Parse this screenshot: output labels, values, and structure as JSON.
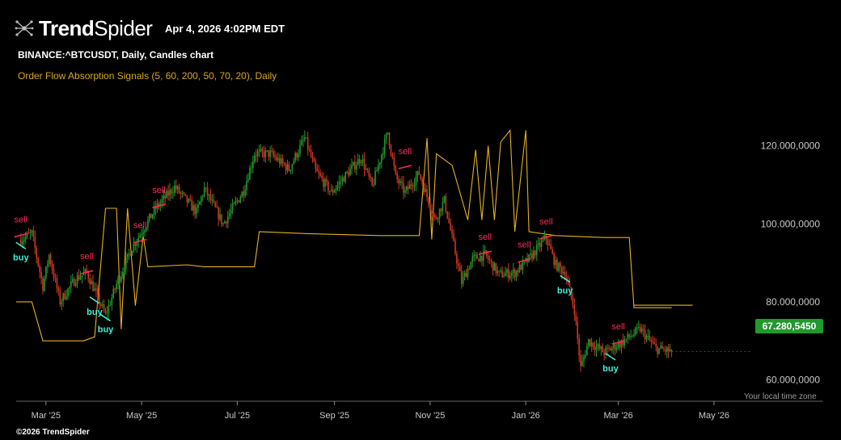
{
  "header": {
    "logo_bold": "Trend",
    "logo_light": "Spider",
    "timestamp": "Apr 4, 2026 4:02PM EDT",
    "symbol_line": "BINANCE:^BTCUSDT, Daily, Candles chart",
    "indicator_line": "Order Flow Absorption Signals (5, 60, 200, 50, 70, 20), Daily"
  },
  "footer": {
    "timezone": "Your local time zone",
    "copyright": "©2026 TrendSpider"
  },
  "colors": {
    "background": "#000000",
    "up": "#1f9a2b",
    "down": "#d0361f",
    "indicator": "#e5b020",
    "sell": "#ff2a5a",
    "buy": "#3ef0d8",
    "axis_text": "#c8c8c8"
  },
  "chart_data": {
    "type": "candlestick",
    "y_axis": {
      "ticks": [
        60000000,
        80000000,
        100000000,
        120000000
      ],
      "tick_labels": [
        "60.000,0000",
        "80.000,0000",
        "100.000,0000",
        "120.000,0000"
      ],
      "ylim": [
        54500000,
        130500000
      ]
    },
    "x_axis": {
      "ticks": [
        "2025-03-01",
        "2025-05-01",
        "2025-07-01",
        "2025-09-01",
        "2025-11-01",
        "2026-01-01",
        "2026-03-01",
        "2026-05-01"
      ],
      "tick_labels": [
        "Mar '25",
        "May '25",
        "Jul '25",
        "Sep '25",
        "Nov '25",
        "Jan '26",
        "Mar '26",
        "May '26"
      ],
      "xlim": [
        "2025-02-10",
        "2026-05-16"
      ]
    },
    "last_price": 67280.545,
    "last_price_label": "67.280,5450",
    "price_path": [
      [
        "2025-02-13",
        96000000
      ],
      [
        "2025-02-20",
        97500000
      ],
      [
        "2025-02-27",
        84000000
      ],
      [
        "2025-03-03",
        92000000
      ],
      [
        "2025-03-10",
        80000000
      ],
      [
        "2025-03-20",
        86000000
      ],
      [
        "2025-03-27",
        87500000
      ],
      [
        "2025-04-08",
        76500000
      ],
      [
        "2025-04-15",
        84500000
      ],
      [
        "2025-04-25",
        94000000
      ],
      [
        "2025-05-10",
        104000000
      ],
      [
        "2025-05-22",
        109500000
      ],
      [
        "2025-06-05",
        103000000
      ],
      [
        "2025-06-10",
        109000000
      ],
      [
        "2025-06-22",
        100000000
      ],
      [
        "2025-07-05",
        108500000
      ],
      [
        "2025-07-12",
        118000000
      ],
      [
        "2025-07-22",
        118000000
      ],
      [
        "2025-08-03",
        114000000
      ],
      [
        "2025-08-13",
        122000000
      ],
      [
        "2025-08-20",
        113500000
      ],
      [
        "2025-08-30",
        108000000
      ],
      [
        "2025-09-05",
        111000000
      ],
      [
        "2025-09-18",
        117000000
      ],
      [
        "2025-09-25",
        109500000
      ],
      [
        "2025-10-05",
        123500000
      ],
      [
        "2025-10-10",
        112000000
      ],
      [
        "2025-10-16",
        108000000
      ],
      [
        "2025-10-25",
        113000000
      ],
      [
        "2025-11-04",
        101000000
      ],
      [
        "2025-11-10",
        106000000
      ],
      [
        "2025-11-21",
        85000000
      ],
      [
        "2025-11-28",
        91000000
      ],
      [
        "2025-12-06",
        92000000
      ],
      [
        "2025-12-15",
        87000000
      ],
      [
        "2025-12-25",
        87500000
      ],
      [
        "2026-01-03",
        91000000
      ],
      [
        "2026-01-14",
        96500000
      ],
      [
        "2026-01-20",
        89500000
      ],
      [
        "2026-01-26",
        87500000
      ],
      [
        "2026-02-01",
        78000000
      ],
      [
        "2026-02-05",
        63000000
      ],
      [
        "2026-02-10",
        70000000
      ],
      [
        "2026-02-20",
        67000000
      ],
      [
        "2026-03-03",
        69500000
      ],
      [
        "2026-03-15",
        73000000
      ],
      [
        "2026-03-25",
        68000000
      ],
      [
        "2026-04-04",
        67280545
      ]
    ],
    "indicator_series": {
      "name": "Order Flow Absorption Signals",
      "path": [
        [
          "2025-02-10",
          80000000
        ],
        [
          "2025-02-20",
          80000000
        ],
        [
          "2025-02-27",
          70000000
        ],
        [
          "2025-03-25",
          70000000
        ],
        [
          "2025-04-01",
          71000000
        ],
        [
          "2025-04-08",
          104000000
        ],
        [
          "2025-04-15",
          104000000
        ],
        [
          "2025-04-18",
          73000000
        ],
        [
          "2025-04-22",
          104000000
        ],
        [
          "2025-04-27",
          79000000
        ],
        [
          "2025-05-02",
          97000000
        ],
        [
          "2025-05-05",
          89000000
        ],
        [
          "2025-05-30",
          89500000
        ],
        [
          "2025-06-10",
          89000000
        ],
        [
          "2025-06-30",
          89000000
        ],
        [
          "2025-07-12",
          89000000
        ],
        [
          "2025-07-15",
          98000000
        ],
        [
          "2025-08-15",
          97500000
        ],
        [
          "2025-09-30",
          97000000
        ],
        [
          "2025-10-25",
          97000000
        ],
        [
          "2025-10-30",
          122000000
        ],
        [
          "2025-11-02",
          96000000
        ],
        [
          "2025-11-05",
          118000000
        ],
        [
          "2025-11-15",
          115000000
        ],
        [
          "2025-11-25",
          101000000
        ],
        [
          "2025-11-30",
          119000000
        ],
        [
          "2025-12-04",
          101000000
        ],
        [
          "2025-12-08",
          120000000
        ],
        [
          "2025-12-12",
          101000000
        ],
        [
          "2025-12-16",
          121000000
        ],
        [
          "2025-12-22",
          124000000
        ],
        [
          "2025-12-25",
          98000000
        ],
        [
          "2026-01-01",
          124000000
        ],
        [
          "2026-01-03",
          98000000
        ],
        [
          "2026-01-20",
          97000000
        ],
        [
          "2026-02-20",
          96500000
        ],
        [
          "2026-03-08",
          96500000
        ],
        [
          "2026-03-11",
          78500000
        ],
        [
          "2026-04-04",
          78500000
        ]
      ]
    },
    "signals": [
      {
        "type": "sell",
        "label": "sell",
        "date": "2025-02-13",
        "price": 97500000
      },
      {
        "type": "buy",
        "label": "buy",
        "date": "2025-02-13",
        "price": 94000000
      },
      {
        "type": "sell",
        "label": "sell",
        "date": "2025-03-27",
        "price": 88000000
      },
      {
        "type": "buy",
        "label": "buy",
        "date": "2025-04-01",
        "price": 80000000
      },
      {
        "type": "buy",
        "label": "buy",
        "date": "2025-04-08",
        "price": 75500000
      },
      {
        "type": "sell",
        "label": "sell",
        "date": "2025-04-30",
        "price": 96000000
      },
      {
        "type": "sell",
        "label": "sell",
        "date": "2025-05-12",
        "price": 105000000
      },
      {
        "type": "sell",
        "label": "sell",
        "date": "2025-10-16",
        "price": 115000000
      },
      {
        "type": "sell",
        "label": "sell",
        "date": "2025-12-06",
        "price": 93000000
      },
      {
        "type": "sell",
        "label": "sell",
        "date": "2025-12-31",
        "price": 91000000
      },
      {
        "type": "sell",
        "label": "sell",
        "date": "2026-01-14",
        "price": 97000000
      },
      {
        "type": "buy",
        "label": "buy",
        "date": "2026-01-26",
        "price": 85500000
      },
      {
        "type": "sell",
        "label": "sell",
        "date": "2026-03-01",
        "price": 70000000
      },
      {
        "type": "buy",
        "label": "buy",
        "date": "2026-02-24",
        "price": 65500000
      }
    ]
  }
}
